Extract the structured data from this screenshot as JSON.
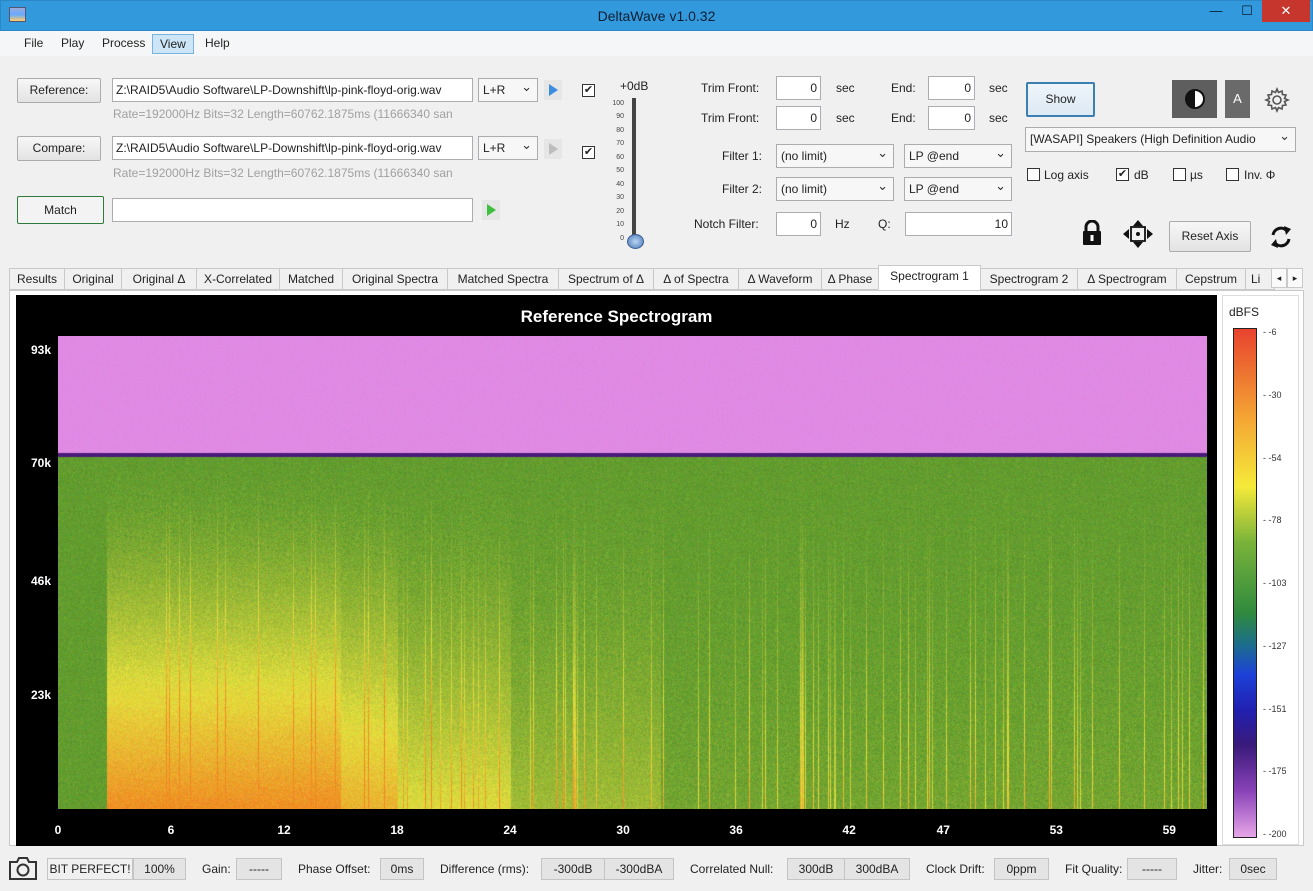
{
  "window": {
    "title": "DeltaWave v1.0.32",
    "min": "—",
    "max": "☐",
    "close": "✕"
  },
  "menu": [
    "File",
    "Play",
    "Process",
    "View",
    "Help"
  ],
  "reference": {
    "button": "Reference:",
    "path": "Z:\\RAID5\\Audio Software\\LP-Downshift\\lp-pink-floyd-orig.wav",
    "info": "Rate=192000Hz Bits=32 Length=60762.1875ms (11666340 san",
    "channel": "L+R",
    "checked": "✔"
  },
  "compare": {
    "button": "Compare:",
    "path": "Z:\\RAID5\\Audio Software\\LP-Downshift\\lp-pink-floyd-orig.wav",
    "info": "Rate=192000Hz Bits=32 Length=60762.1875ms (11666340 san",
    "channel": "L+R",
    "checked": "✔"
  },
  "match": {
    "button": "Match",
    "value": ""
  },
  "volume": {
    "label": "+0dB",
    "ticks": [
      "100",
      "90",
      "80",
      "70",
      "60",
      "50",
      "40",
      "30",
      "20",
      "10",
      "0"
    ],
    "level": 0
  },
  "trim": {
    "front_label": "Trim Front:",
    "end_label": "End:",
    "unit": "sec",
    "ref_front": "0",
    "ref_end": "0",
    "cmp_front": "0",
    "cmp_end": "0"
  },
  "filters": {
    "f1_label": "Filter 1:",
    "f1_value": "(no limit)",
    "f1_mode": "LP @end",
    "f2_label": "Filter 2:",
    "f2_value": "(no limit)",
    "f2_mode": "LP @end",
    "notch_label": "Notch Filter:",
    "notch_value": "0",
    "notch_unit": "Hz",
    "q_label": "Q:",
    "q_value": "10"
  },
  "right_panel": {
    "show_button": "Show",
    "font_button": "A",
    "device": "[WASAPI] Speakers (High Definition Audio",
    "log_axis": "Log axis",
    "db": "dB",
    "db_checked": "✔",
    "us": "µs",
    "inv": "Inv. Φ",
    "reset_axis": "Reset Axis"
  },
  "tabs": [
    "Results",
    "Original",
    "Original Δ",
    "X-Correlated",
    "Matched",
    "Original Spectra",
    "Matched Spectra",
    "Spectrum of Δ",
    "Δ of Spectra",
    "Δ Waveform",
    "Δ Phase",
    "Spectrogram 1",
    "Spectrogram 2",
    "Δ Spectrogram",
    "Cepstrum",
    "Li"
  ],
  "active_tab": "Spectrogram 1",
  "tab_arrows": [
    "◂",
    "▸"
  ],
  "chart_data": {
    "type": "heatmap",
    "title": "Reference Spectrogram",
    "xlabel": "",
    "ylabel": "",
    "x_ticks": [
      "0",
      "6",
      "12",
      "18",
      "24",
      "30",
      "36",
      "42",
      "47",
      "53",
      "59"
    ],
    "x_tick_values": [
      0,
      6,
      12,
      18,
      24,
      30,
      36,
      42,
      47,
      53,
      59
    ],
    "y_ticks": [
      "93k",
      "70k",
      "46k",
      "23k"
    ],
    "y_tick_values": [
      93000,
      70000,
      46000,
      23000
    ],
    "xlim": [
      0,
      61
    ],
    "ylim": [
      0,
      96000
    ],
    "content_cutoff_hz": 72000,
    "music_onset_s": 2.6,
    "colorbar": {
      "label": "dBFS",
      "ticks": [
        "-6",
        "-30",
        "-54",
        "-78",
        "-103",
        "-127",
        "-151",
        "-175",
        "-200"
      ]
    },
    "colors": {
      "above_cutoff": "#e08ae4",
      "cutoff_line": "#4a1a7a",
      "floor": "#5e9a2e",
      "hot_low": "#f08a22",
      "mid": "#e3de3e"
    }
  },
  "status": {
    "bit_perfect": "BIT PERFECT!",
    "bit_perfect_value": "100%",
    "gain_label": "Gain:",
    "gain_value": "-----",
    "phase_label": "Phase Offset:",
    "phase_value": "0ms",
    "diff_label": "Difference (rms):",
    "diff_db": "-300dB",
    "diff_dba": "-300dBA",
    "null_label": "Correlated Null:",
    "null_db": "300dB",
    "null_dba": "300dBA",
    "drift_label": "Clock Drift:",
    "drift_value": "0ppm",
    "fit_label": "Fit Quality:",
    "fit_value": "-----",
    "jitter_label": "Jitter:",
    "jitter_value": "0sec"
  }
}
